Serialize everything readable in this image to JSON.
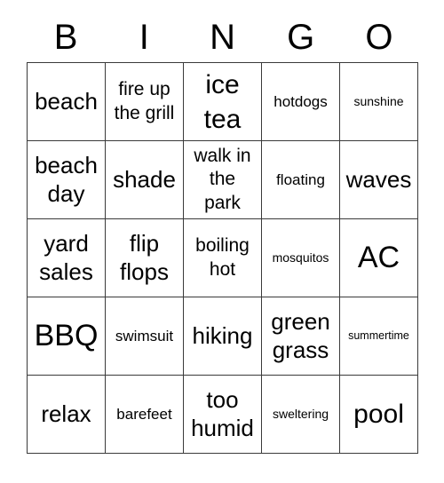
{
  "card": {
    "title": "BINGO",
    "header_letters": [
      "B",
      "I",
      "N",
      "G",
      "O"
    ],
    "columns": 5,
    "rows": 5,
    "border_color": "#3a3a3a",
    "text_color": "#000000",
    "background_color": "#ffffff",
    "grid": [
      [
        {
          "text": "beach",
          "size": "l"
        },
        {
          "text": "fire up\nthe grill",
          "size": "m"
        },
        {
          "text": "ice\ntea",
          "size": "xl"
        },
        {
          "text": "hotdogs",
          "size": "s"
        },
        {
          "text": "sunshine",
          "size": "xs"
        }
      ],
      [
        {
          "text": "beach\nday",
          "size": "l"
        },
        {
          "text": "shade",
          "size": "l"
        },
        {
          "text": "walk in\nthe\npark",
          "size": "m"
        },
        {
          "text": "floating",
          "size": "s"
        },
        {
          "text": "waves",
          "size": "l"
        }
      ],
      [
        {
          "text": "yard\nsales",
          "size": "l"
        },
        {
          "text": "flip\nflops",
          "size": "l"
        },
        {
          "text": "boiling\nhot",
          "size": "m"
        },
        {
          "text": "mosquitos",
          "size": "xs"
        },
        {
          "text": "AC",
          "size": "xxl"
        }
      ],
      [
        {
          "text": "BBQ",
          "size": "xxl"
        },
        {
          "text": "swimsuit",
          "size": "s"
        },
        {
          "text": "hiking",
          "size": "l"
        },
        {
          "text": "green\ngrass",
          "size": "l"
        },
        {
          "text": "summertime",
          "size": "xxs"
        }
      ],
      [
        {
          "text": "relax",
          "size": "l"
        },
        {
          "text": "barefeet",
          "size": "s"
        },
        {
          "text": "too\nhumid",
          "size": "l"
        },
        {
          "text": "sweltering",
          "size": "xs"
        },
        {
          "text": "pool",
          "size": "xl"
        }
      ]
    ]
  }
}
